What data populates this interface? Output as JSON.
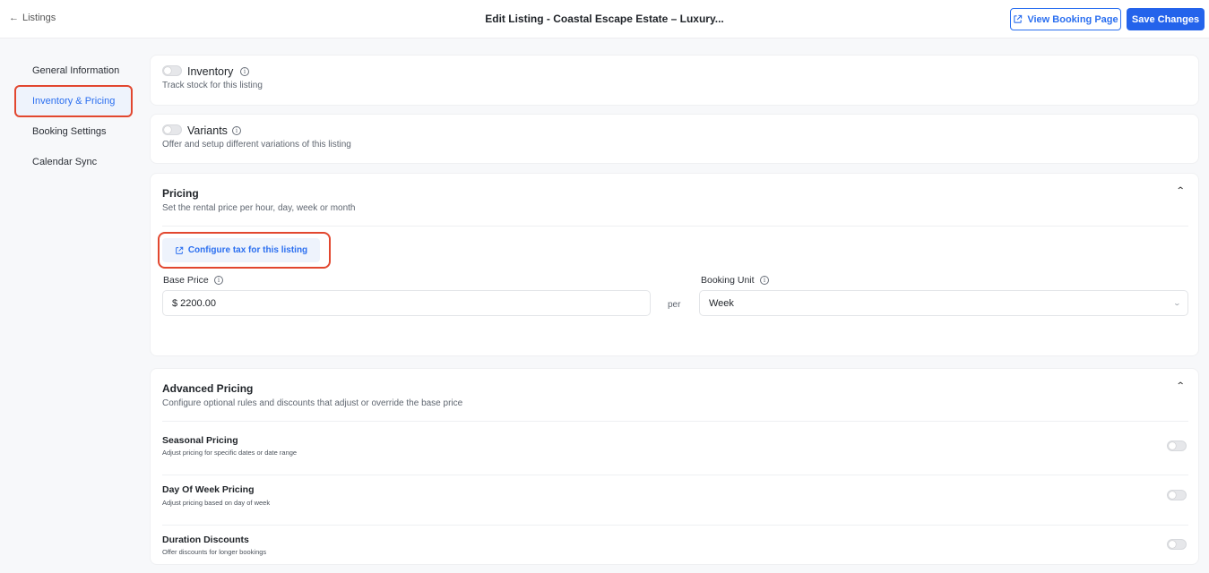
{
  "header": {
    "back_label": "Listings",
    "title": "Edit Listing - Coastal Escape Estate – Luxury...",
    "view_booking_label": "View Booking Page",
    "save_label": "Save Changes"
  },
  "sidebar": {
    "items": [
      {
        "label": "General Information",
        "active": false
      },
      {
        "label": "Inventory & Pricing",
        "active": true
      },
      {
        "label": "Booking Settings",
        "active": false
      },
      {
        "label": "Calendar Sync",
        "active": false
      }
    ]
  },
  "inventory": {
    "title": "Inventory",
    "subtitle": "Track stock for this listing",
    "enabled": false
  },
  "variants": {
    "title": "Variants",
    "subtitle": "Offer and setup different variations of this listing",
    "enabled": false
  },
  "pricing": {
    "title": "Pricing",
    "subtitle": "Set the rental price per hour, day, week or month",
    "tax_button_label": "Configure tax for this listing",
    "base_price_label": "Base Price",
    "base_price_value": "$ 2200.00",
    "per_label": "per",
    "booking_unit_label": "Booking Unit",
    "booking_unit_value": "Week"
  },
  "advanced_pricing": {
    "title": "Advanced Pricing",
    "subtitle": "Configure optional rules and discounts that adjust or override the base price",
    "rules": [
      {
        "title": "Seasonal Pricing",
        "subtitle": "Adjust pricing for specific dates or date range",
        "enabled": false
      },
      {
        "title": "Day Of Week Pricing",
        "subtitle": "Adjust pricing based on day of week",
        "enabled": false
      },
      {
        "title": "Duration Discounts",
        "subtitle": "Offer discounts for longer bookings",
        "enabled": false
      }
    ]
  },
  "colors": {
    "accent": "#2463eb",
    "highlight": "#e2472f"
  }
}
